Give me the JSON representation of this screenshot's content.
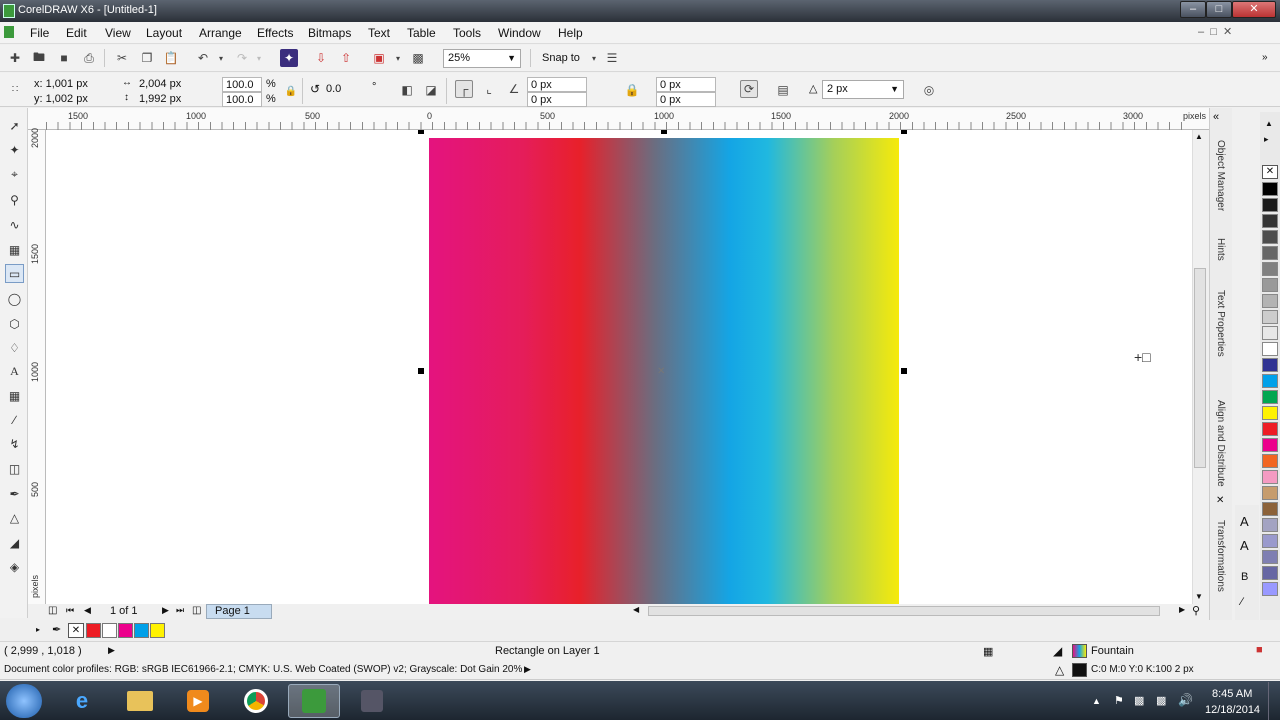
{
  "window": {
    "title": "CorelDRAW X6 - [Untitled-1]"
  },
  "menu": [
    "File",
    "Edit",
    "View",
    "Layout",
    "Arrange",
    "Effects",
    "Bitmaps",
    "Text",
    "Table",
    "Tools",
    "Window",
    "Help"
  ],
  "toolbar1": {
    "zoom": "25%",
    "snap_label": "Snap to"
  },
  "toolbar2": {
    "x": "x: 1,001 px",
    "y": "y: 1,002 px",
    "width": "2,004 px",
    "height": "1,992 px",
    "scale_x": "100.0",
    "scale_y": "100.0",
    "percent": "%",
    "rotation": "0.0",
    "degree": "°",
    "corner1": "0 px",
    "corner2": "0 px",
    "corner3": "0 px",
    "corner4": "0 px",
    "outline": "2 px"
  },
  "ruler": {
    "h_labels": [
      "1500",
      "1000",
      "500",
      "0",
      "500",
      "1000",
      "1500",
      "2000",
      "2500",
      "3000",
      "pixels"
    ],
    "v_labels": [
      "2000",
      "1500",
      "1000",
      "500",
      "pixels"
    ]
  },
  "dockers": [
    "Object Manager",
    "Hints",
    "Text Properties",
    "Align and Distribute",
    "Transformations"
  ],
  "palette": [
    "#ffffff",
    "#000000",
    "#1a1a1a",
    "#333333",
    "#4d4d4d",
    "#666666",
    "#808080",
    "#999999",
    "#b3b3b3",
    "#cccccc",
    "#e6e6e6",
    "#ffffff",
    "#2e3192",
    "#00a0e9",
    "#00a651",
    "#fff200",
    "#ed1c24",
    "#ec008c",
    "#f26522",
    "#f49ac2",
    "#c69c6d",
    "#8c6239",
    "#a3a3c2",
    "#9999cc",
    "#7f7fb2",
    "#6666a3",
    "#9999ff"
  ],
  "pagebar": {
    "page_count": "1 of 1",
    "page_tab": "Page 1"
  },
  "doc_palette": [
    "#ed1c24",
    "#ffffff",
    "#ec008c",
    "#00a0e9",
    "#fff200"
  ],
  "status": {
    "coords": "( 2,999 , 1,018 )",
    "object": "Rectangle on Layer 1",
    "fill_type": "Fountain",
    "outline_info": "C:0 M:0 Y:0 K:100  2 px",
    "profiles": "Document color profiles: RGB: sRGB IEC61966-2.1; CMYK: U.S. Web Coated (SWOP) v2; Grayscale: Dot Gain 20%"
  },
  "taskbar": {
    "time": "8:45 AM",
    "date": "12/18/2014"
  }
}
